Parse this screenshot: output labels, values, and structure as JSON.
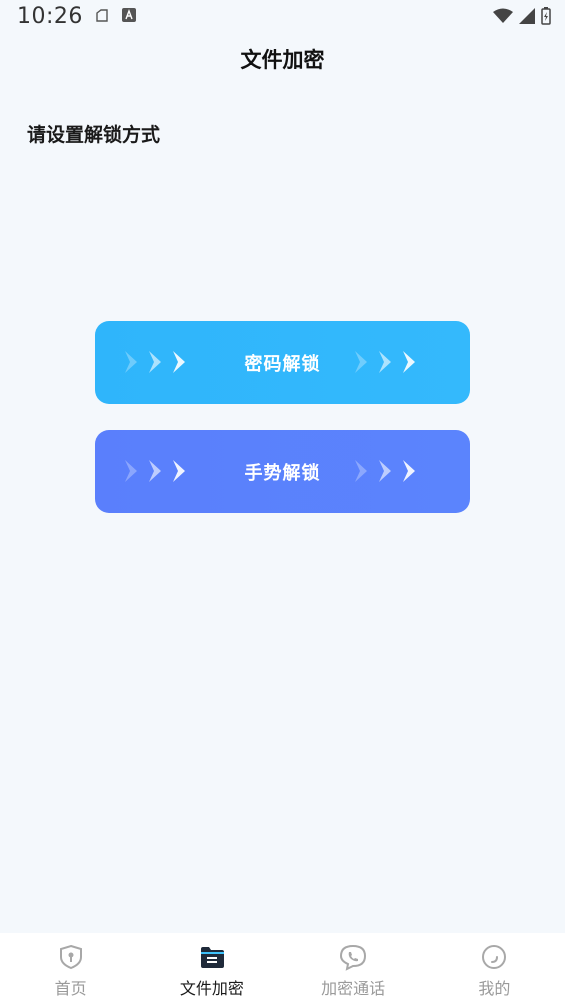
{
  "status_bar": {
    "time": "10:26"
  },
  "header": {
    "title": "文件加密"
  },
  "main": {
    "section_title": "请设置解锁方式",
    "buttons": [
      {
        "label": "密码解锁",
        "color": "#2fb5fb"
      },
      {
        "label": "手势解锁",
        "color": "#5a7ffc"
      }
    ]
  },
  "tab_bar": {
    "active_color": "#1a1a1a",
    "inactive_color": "#9a9a9a",
    "items": [
      {
        "label": "首页",
        "icon": "shield-icon",
        "active": false
      },
      {
        "label": "文件加密",
        "icon": "folder-icon",
        "active": true
      },
      {
        "label": "加密通话",
        "icon": "phone-chat-icon",
        "active": false
      },
      {
        "label": "我的",
        "icon": "profile-icon",
        "active": false
      }
    ]
  }
}
